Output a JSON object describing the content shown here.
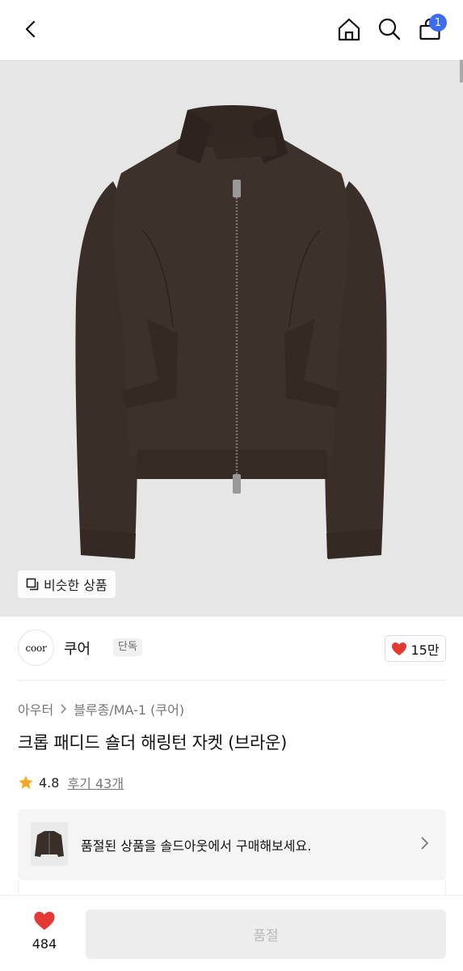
{
  "nav": {
    "cart_count": "1"
  },
  "hero": {
    "similar_label": "비슷한 상품"
  },
  "brand": {
    "logo_text": "coor",
    "name": "쿠어",
    "tag": "단독",
    "likes": "15만"
  },
  "breadcrumb": [
    "아우터",
    "블루종/MA-1 (쿠어)"
  ],
  "product": {
    "title": "크롭 패디드 숄더 해링턴 자켓 (브라운)"
  },
  "rating": {
    "value": "4.8",
    "score": 4.8,
    "reviews_label": "후기 43개"
  },
  "soldout": {
    "text": "품절된 상품을 솔드아웃에서 구매해보세요."
  },
  "bottom": {
    "wish_count": "484",
    "buy_label": "품절"
  },
  "colors": {
    "accent": "#3d6cf2",
    "heart": "#e53935",
    "star": "#f5a623",
    "jacket": "#3b2f29"
  },
  "icons": [
    "back-arrow-icon",
    "home-icon",
    "search-icon",
    "cart-icon",
    "similar-items-icon",
    "heart-icon",
    "star-icon",
    "chevron-right-icon"
  ]
}
